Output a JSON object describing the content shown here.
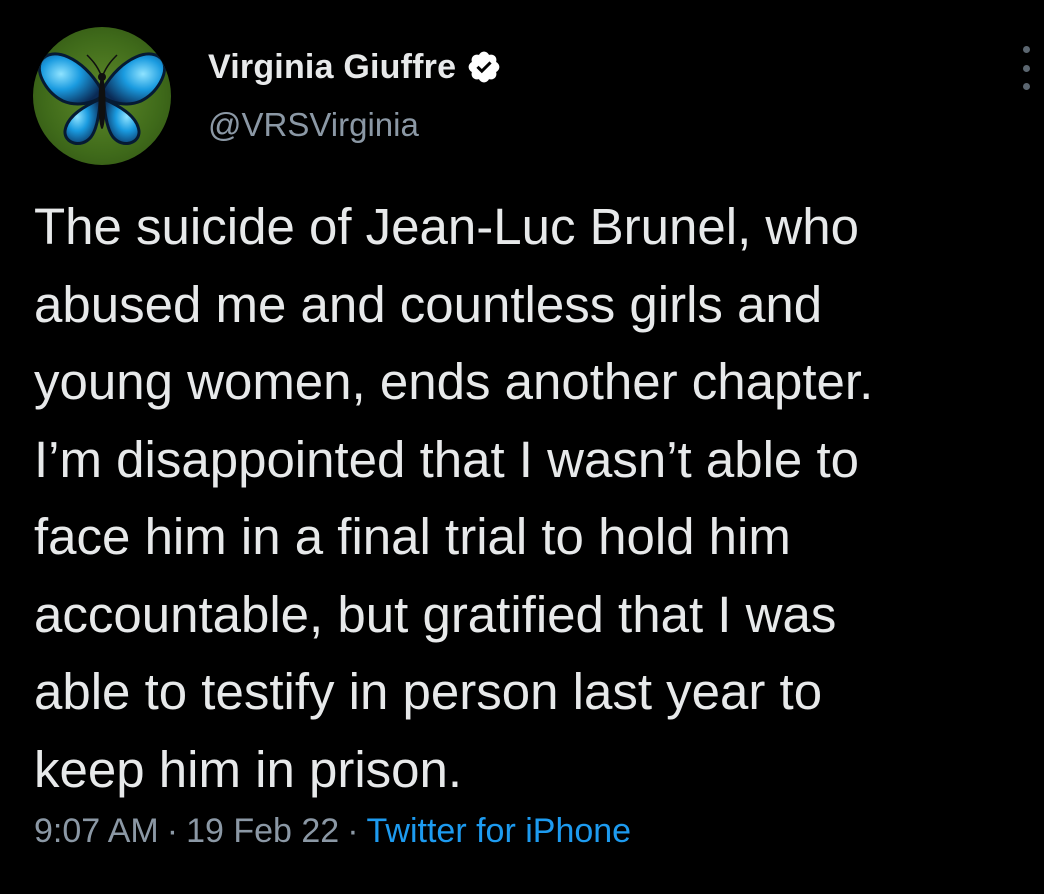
{
  "author": {
    "display_name": "Virginia Giuffre",
    "handle": "@VRSVirginia",
    "verified": true,
    "avatar_icon": "blue-butterfly-avatar"
  },
  "tweet": {
    "text_lines": [
      "The suicide of Jean-Luc Brunel, who",
      "abused me and countless girls and",
      "young women, ends another chapter.",
      "I’m disappointed that I wasn’t able to",
      "face him in a final trial to hold him",
      "accountable, but gratified that I was",
      "able to testify in person last year to",
      "keep him in prison."
    ],
    "time": "9:07 AM",
    "date": "19 Feb 22",
    "separator": "·",
    "source": "Twitter for iPhone"
  },
  "colors": {
    "background": "#000000",
    "primary_text": "#e7e9ea",
    "secondary_text": "#8b98a5",
    "link": "#1d9bf0"
  },
  "icons": {
    "verified": "verified-badge-icon",
    "more": "more-options-icon"
  }
}
